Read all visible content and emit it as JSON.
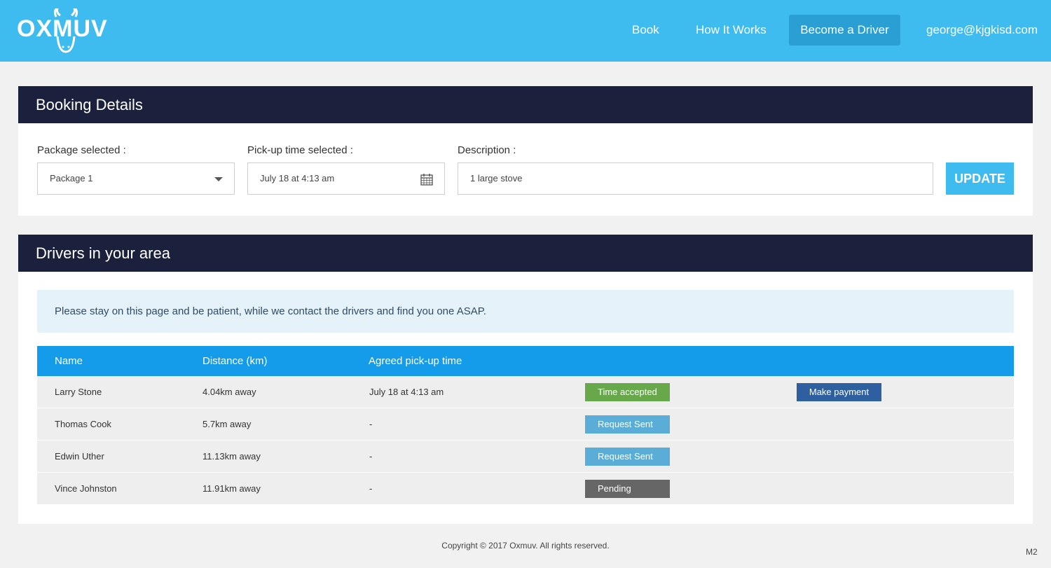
{
  "header": {
    "logo_text": "OXMUV",
    "nav": {
      "book": "Book",
      "how_it_works": "How It Works",
      "become_driver": "Become a Driver",
      "user_email": "george@kjgkisd.com"
    }
  },
  "booking": {
    "title": "Booking Details",
    "package_label": "Package selected :",
    "package_value": "Package 1",
    "pickup_label": "Pick-up time selected :",
    "pickup_value": "July 18 at 4:13 am",
    "description_label": "Description :",
    "description_value": "1 large stove",
    "update_label": "UPDATE"
  },
  "drivers": {
    "title": "Drivers in your area",
    "notice": "Please stay on this page and be patient, while we contact the drivers and find you one ASAP.",
    "columns": [
      "Name",
      "Distance (km)",
      "Agreed pick-up time"
    ],
    "rows": [
      {
        "name": "Larry Stone",
        "distance": "4.04km away",
        "time": "July 18 at 4:13 am",
        "status": "Time accepted",
        "status_color": "#67a84a",
        "action": "Make payment"
      },
      {
        "name": "Thomas Cook",
        "distance": "5.7km away",
        "time": "-",
        "status": "Request Sent",
        "status_color": "#5aadd6",
        "action": ""
      },
      {
        "name": "Edwin Uther",
        "distance": "11.13km away",
        "time": "-",
        "status": "Request Sent",
        "status_color": "#5aadd6",
        "action": ""
      },
      {
        "name": "Vince Johnston",
        "distance": "11.91km away",
        "time": "-",
        "status": "Pending",
        "status_color": "#666666",
        "action": ""
      }
    ]
  },
  "footer": {
    "copyright": "Copyright  ©  2017  Oxmuv.  All rights reserved.",
    "version": "M2"
  },
  "colors": {
    "header_bg": "#3ebbef",
    "panel_header_bg": "#1b213d",
    "table_header_bg": "#149ceb",
    "pay_button": "#2e5f9f"
  },
  "icons": [
    "oxmuv-logo",
    "chevron-down-icon",
    "calendar-icon"
  ]
}
